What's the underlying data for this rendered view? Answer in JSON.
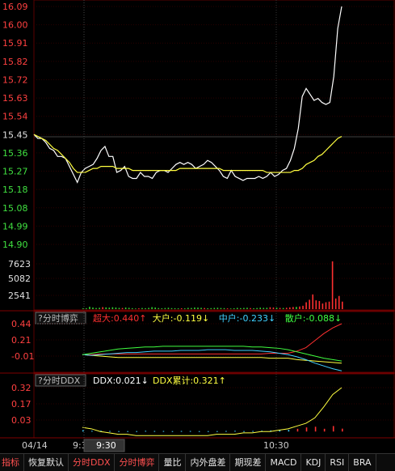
{
  "header_top_label": "15.45",
  "price_panel": {
    "ylabels": [
      "16.09",
      "16.00",
      "15.91",
      "15.82",
      "15.72",
      "15.63",
      "15.54",
      "15.45",
      "15.36",
      "15.27",
      "15.18",
      "15.08",
      "14.99",
      "14.90"
    ],
    "ylabel_colors": [
      "#ff4040",
      "#ff4040",
      "#ff4040",
      "#ff4040",
      "#ff4040",
      "#ff4040",
      "#ff4040",
      "#e0e0e0",
      "#40e040",
      "#40e040",
      "#40e040",
      "#40e040",
      "#40e040",
      "#40e040"
    ]
  },
  "volume_panel": {
    "ylabels": [
      "7623",
      "5082",
      "2541"
    ]
  },
  "boyi_panel": {
    "button": "?分时博弈",
    "indicators": [
      {
        "label": "超大:0.440↑",
        "color": "#ff3030"
      },
      {
        "label": "大户:-0.119↓",
        "color": "#ffff40"
      },
      {
        "label": "中户:-0.233↓",
        "color": "#40d0ff"
      },
      {
        "label": "散户:-0.088↓",
        "color": "#40ff40"
      }
    ],
    "ylabels": [
      "0.44",
      "0.21",
      "-0.01"
    ]
  },
  "ddx_panel": {
    "button": "?分时DDX",
    "indicators": [
      {
        "label": "DDX:0.021↓",
        "color": "#ffffff"
      },
      {
        "label": "DDX累计:0.321↑",
        "color": "#ffff40"
      }
    ],
    "ylabels": [
      "0.32",
      "0.17",
      "0.03"
    ]
  },
  "time_axis": {
    "date": "04/14",
    "start": "9:3",
    "cursor": "9:30",
    "mid": "10:30"
  },
  "tabs": [
    {
      "label": "指标",
      "red": true
    },
    {
      "label": "恢复默认",
      "red": false
    },
    {
      "label": "分时DDX",
      "red": true
    },
    {
      "label": "分时博弈",
      "red": true
    },
    {
      "label": "量比",
      "red": false
    },
    {
      "label": "内外盘差",
      "red": false
    },
    {
      "label": "期现差",
      "red": false
    },
    {
      "label": "MACD",
      "red": false
    },
    {
      "label": "KDJ",
      "red": false
    },
    {
      "label": "RSI",
      "red": false
    },
    {
      "label": "BRA",
      "red": false
    }
  ],
  "chart_data": [
    {
      "type": "line",
      "title": "",
      "ylim": [
        14.9,
        16.09
      ],
      "series": [
        {
          "values": [
            15.45,
            15.43,
            15.43,
            15.41,
            15.38,
            15.37,
            15.34,
            15.34,
            15.33,
            15.29,
            15.25,
            15.21,
            15.26,
            15.28,
            15.29,
            15.3,
            15.33,
            15.37,
            15.39,
            15.34,
            15.34,
            15.26,
            15.27,
            15.29,
            15.24,
            15.23,
            15.23,
            15.26,
            15.24,
            15.24,
            15.23,
            15.26,
            15.27,
            15.27,
            15.26,
            15.28,
            15.3,
            15.31,
            15.3,
            15.31,
            15.3,
            15.28,
            15.29,
            15.3,
            15.32,
            15.31,
            15.29,
            15.27,
            15.24,
            15.23,
            15.27,
            15.24,
            15.23,
            15.22,
            15.23,
            15.23,
            15.23,
            15.24,
            15.23,
            15.24,
            15.26,
            15.24,
            15.25,
            15.27,
            15.28,
            15.32,
            15.38,
            15.48,
            15.64,
            15.68,
            15.65,
            15.62,
            15.63,
            15.61,
            15.6,
            15.61,
            15.74,
            15.98,
            16.09
          ],
          "color": "#ffffff"
        },
        {
          "values": [
            15.45,
            15.44,
            15.43,
            15.42,
            15.4,
            15.38,
            15.37,
            15.35,
            15.33,
            15.31,
            15.28,
            15.26,
            15.26,
            15.26,
            15.27,
            15.28,
            15.28,
            15.29,
            15.29,
            15.29,
            15.29,
            15.28,
            15.28,
            15.28,
            15.28,
            15.27,
            15.27,
            15.27,
            15.27,
            15.27,
            15.27,
            15.27,
            15.27,
            15.27,
            15.27,
            15.27,
            15.27,
            15.28,
            15.28,
            15.28,
            15.28,
            15.28,
            15.28,
            15.28,
            15.28,
            15.28,
            15.28,
            15.28,
            15.27,
            15.27,
            15.27,
            15.27,
            15.27,
            15.27,
            15.27,
            15.27,
            15.27,
            15.27,
            15.27,
            15.26,
            15.26,
            15.26,
            15.26,
            15.26,
            15.26,
            15.26,
            15.27,
            15.27,
            15.28,
            15.3,
            15.31,
            15.32,
            15.34,
            15.35,
            15.37,
            15.39,
            15.41,
            15.43,
            15.44
          ],
          "color": "#ffff40"
        }
      ]
    },
    {
      "type": "bar",
      "ylim": [
        0,
        7623
      ],
      "values": [
        120,
        150,
        380,
        260,
        180,
        220,
        320,
        280,
        240,
        300,
        260,
        200,
        180,
        260,
        210,
        150,
        100,
        120,
        180,
        150,
        200,
        320,
        260,
        170,
        140,
        180,
        220,
        160,
        150,
        130,
        140,
        120,
        200,
        180,
        260,
        240,
        210,
        180,
        140,
        160,
        200,
        220,
        180,
        160,
        120,
        100,
        140,
        200,
        160,
        190,
        220,
        170,
        140,
        180,
        240,
        200,
        220,
        300,
        260,
        240,
        200,
        180,
        220,
        280,
        340,
        360,
        420,
        540,
        1100,
        1500,
        2350,
        1400,
        1300,
        900,
        1100,
        1200,
        7623,
        1700,
        2100,
        1200
      ],
      "colors": [
        "g",
        "g",
        "g",
        "g",
        "g",
        "g",
        "r",
        "g",
        "g",
        "g",
        "g",
        "g",
        "r",
        "g",
        "g",
        "g",
        "g",
        "r",
        "g",
        "g",
        "g",
        "g",
        "g",
        "g",
        "g",
        "g",
        "g",
        "g",
        "g",
        "g",
        "r",
        "g",
        "g",
        "g",
        "g",
        "g",
        "g",
        "r",
        "g",
        "g",
        "g",
        "g",
        "g",
        "g",
        "r",
        "g",
        "g",
        "g",
        "g",
        "g",
        "g",
        "r",
        "g",
        "g",
        "g",
        "g",
        "g",
        "r",
        "r",
        "g",
        "r",
        "g",
        "r",
        "r",
        "r",
        "g",
        "r",
        "r",
        "r",
        "r",
        "r",
        "r",
        "r",
        "r",
        "r",
        "r",
        "r",
        "r",
        "r",
        "r"
      ]
    },
    {
      "type": "line",
      "ylim": [
        -0.25,
        0.44
      ],
      "series": [
        {
          "name": "超大",
          "values": [
            0.0,
            0.0,
            0.01,
            0.01,
            0.01,
            0.01,
            0.01,
            0.01,
            0.01,
            0.01,
            0.01,
            0.01,
            0.01,
            0.01,
            0.01,
            0.01,
            0.01,
            0.01,
            0.01,
            0.01,
            0.01,
            0.02,
            0.02,
            0.02,
            0.05,
            0.1,
            0.2,
            0.3,
            0.38,
            0.44
          ],
          "color": "#ff3030"
        },
        {
          "name": "大户",
          "values": [
            0.0,
            -0.01,
            -0.02,
            -0.03,
            -0.04,
            -0.04,
            -0.04,
            -0.04,
            -0.04,
            -0.04,
            -0.04,
            -0.04,
            -0.04,
            -0.04,
            -0.04,
            -0.04,
            -0.04,
            -0.04,
            -0.04,
            -0.04,
            -0.04,
            -0.05,
            -0.05,
            -0.05,
            -0.07,
            -0.08,
            -0.09,
            -0.1,
            -0.11,
            -0.12
          ],
          "color": "#ffff40"
        },
        {
          "name": "中户",
          "values": [
            0.0,
            -0.01,
            0.0,
            0.01,
            0.02,
            0.03,
            0.03,
            0.04,
            0.05,
            0.05,
            0.05,
            0.06,
            0.06,
            0.06,
            0.07,
            0.07,
            0.07,
            0.06,
            0.06,
            0.06,
            0.05,
            0.04,
            0.02,
            0.0,
            -0.03,
            -0.07,
            -0.12,
            -0.16,
            -0.2,
            -0.23
          ],
          "color": "#40d0ff"
        },
        {
          "name": "散户",
          "values": [
            0.0,
            0.02,
            0.04,
            0.06,
            0.08,
            0.09,
            0.1,
            0.11,
            0.11,
            0.12,
            0.12,
            0.12,
            0.12,
            0.12,
            0.12,
            0.12,
            0.12,
            0.12,
            0.12,
            0.11,
            0.11,
            0.1,
            0.09,
            0.07,
            0.04,
            0.01,
            -0.02,
            -0.05,
            -0.07,
            -0.09
          ],
          "color": "#40ff40"
        }
      ]
    },
    {
      "type": "line",
      "ylim": [
        -0.04,
        0.32
      ],
      "series": [
        {
          "name": "DDX累计",
          "values": [
            0.03,
            0.02,
            0.0,
            -0.01,
            -0.02,
            -0.02,
            -0.03,
            -0.03,
            -0.03,
            -0.03,
            -0.03,
            -0.03,
            -0.03,
            -0.03,
            -0.03,
            -0.02,
            -0.02,
            -0.02,
            -0.01,
            -0.01,
            0.0,
            0.0,
            0.01,
            0.02,
            0.04,
            0.06,
            0.1,
            0.18,
            0.27,
            0.32
          ],
          "color": "#ffff40"
        }
      ],
      "bars": [
        0.01,
        0.005,
        0.006,
        0.004,
        0.003,
        0.003,
        0.003,
        0.005,
        0.004,
        0.004,
        0.003,
        0.004,
        0.004,
        0.003,
        0.003,
        0.003,
        0.004,
        0.005,
        0.003,
        0.004,
        0.006,
        0.008,
        0.01,
        0.012,
        0.02,
        0.03,
        0.035,
        0.02,
        0.04,
        0.021
      ]
    }
  ]
}
